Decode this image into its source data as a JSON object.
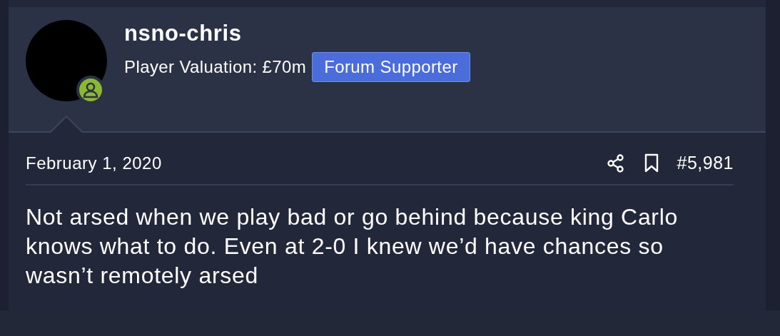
{
  "post": {
    "author": {
      "username": "nsno-chris",
      "valuation": "Player Valuation: £70m",
      "badge": "Forum Supporter",
      "online": true
    },
    "date": "February 1, 2020",
    "number": "#5,981",
    "message": "Not arsed when we play bad or go behind because king Carlo knows what to do. Even at 2-0 I knew we’d have chances so wasn’t remotely arsed"
  }
}
